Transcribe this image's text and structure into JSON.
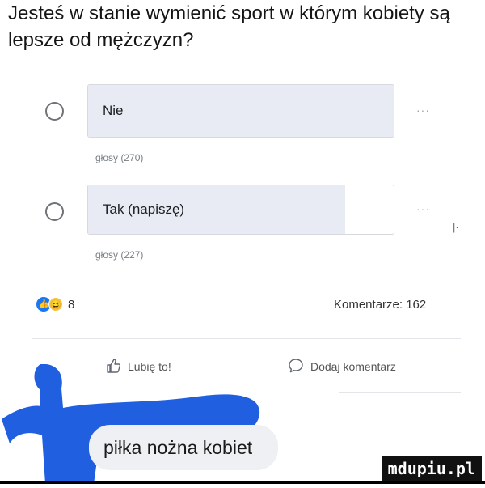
{
  "poll": {
    "question": "Jesteś w stanie wymienić sport w którym kobiety są lepsze od mężczyzn?",
    "options": [
      {
        "label": "Nie",
        "votes_text": "głosy (270)",
        "more": "···",
        "share": 1.0
      },
      {
        "label": "Tak (napiszę)",
        "votes_text": "głosy (227)",
        "more": "···",
        "share": 0.84
      }
    ]
  },
  "reactions": {
    "count": "8",
    "types": [
      "like-icon",
      "haha-icon"
    ]
  },
  "comments": {
    "count_text": "Komentarze: 162"
  },
  "actions": {
    "like": "Lubię to!",
    "comment": "Dodaj komentarz"
  },
  "reply": {
    "text": "piłka nożna kobiet"
  },
  "watermark": {
    "text": "mdupiu.pl"
  },
  "side_mark": "|·",
  "colors": {
    "accent": "#1877f2",
    "poll_fill": "#e8ebf3",
    "bubble": "#eef0f3",
    "sticker": "#1f5fe0"
  }
}
